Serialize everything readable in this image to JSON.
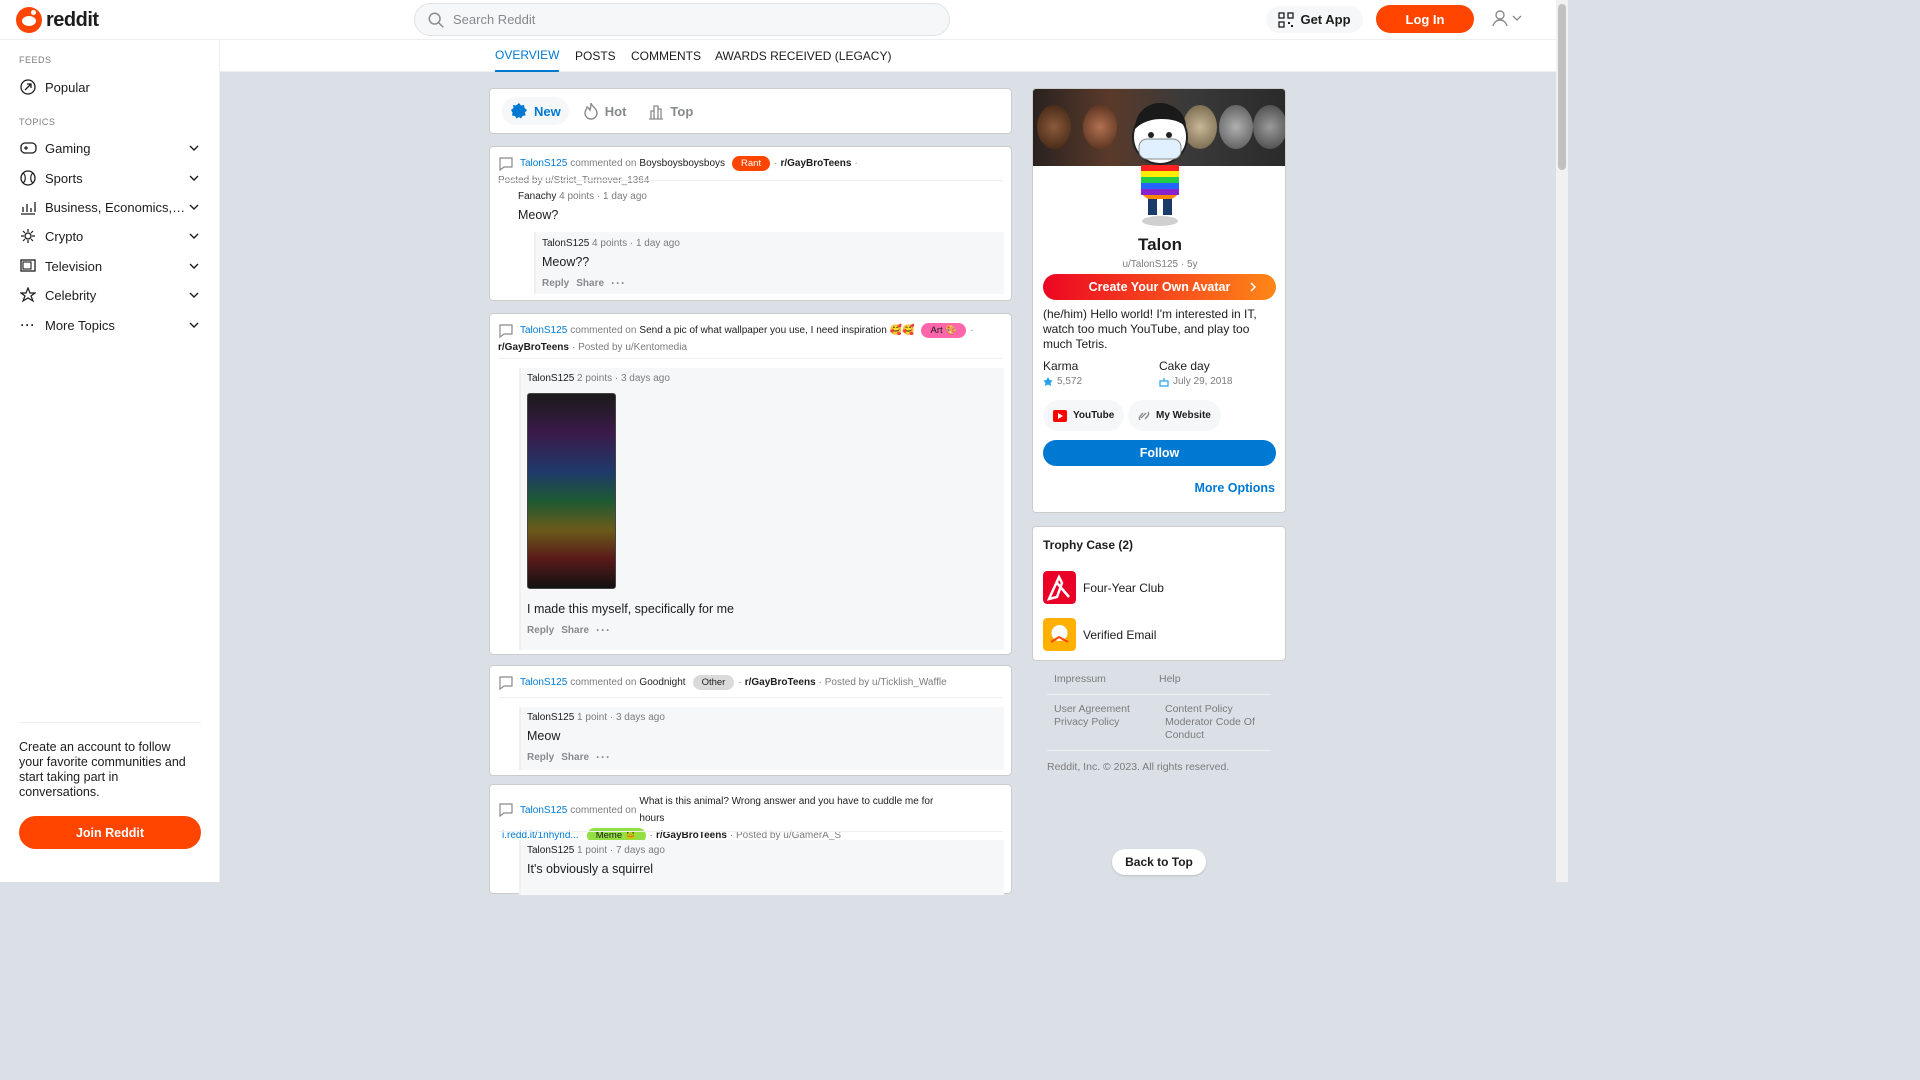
{
  "header": {
    "logo_text": "reddit",
    "search_placeholder": "Search Reddit",
    "get_app": "Get App",
    "login": "Log In"
  },
  "sidebar": {
    "feeds_label": "FEEDS",
    "popular": "Popular",
    "topics_label": "TOPICS",
    "topics": [
      "Gaming",
      "Sports",
      "Business, Economics, and Finance",
      "Crypto",
      "Television",
      "Celebrity",
      "More Topics"
    ],
    "cta": "Create an account to follow your favorite communities and start taking part in conversations.",
    "join": "Join Reddit"
  },
  "tabs": [
    "OVERVIEW",
    "POSTS",
    "COMMENTS",
    "AWARDS RECEIVED (LEGACY)"
  ],
  "sort": {
    "new": "New",
    "hot": "Hot",
    "top": "Top"
  },
  "actions": {
    "reply": "Reply",
    "share": "Share"
  },
  "cards": [
    {
      "user": "TalonS125",
      "verb": "commented on",
      "post_title": "Boysboysboysboys",
      "flair": "Rant",
      "community": "r/GayBroTeens",
      "posted_by": "Posted by u/Strict_Turnover_1364",
      "parent": {
        "author": "Fanachy",
        "meta": "4 points · 1 day ago",
        "body": "Meow?"
      },
      "reply": {
        "author": "TalonS125",
        "meta": "4 points · 1 day ago",
        "body": "Meow??"
      }
    },
    {
      "user": "TalonS125",
      "verb": "commented on",
      "post_title": "Send a pic of what wallpaper you use, I need inspiration 🥰🥰",
      "flair": "Art 🎨",
      "community": "r/GayBroTeens",
      "posted_by": "Posted by u/Kentomedia",
      "reply": {
        "author": "TalonS125",
        "meta": "2 points · 3 days ago",
        "body": "I made this myself, specifically for me"
      }
    },
    {
      "user": "TalonS125",
      "verb": "commented on",
      "post_title": "Goodnight",
      "flair": "Other",
      "community": "r/GayBroTeens",
      "posted_by": "Posted by u/Ticklish_Waffle",
      "reply": {
        "author": "TalonS125",
        "meta": "1 point · 3 days ago",
        "body": "Meow"
      }
    },
    {
      "user": "TalonS125",
      "verb": "commented on",
      "post_title": "What is this animal? Wrong answer and you have to cuddle me for hours",
      "link": "i.redd.it/1nhynd...",
      "flair": "Meme 🐸",
      "community": "r/GayBroTeens",
      "posted_by": "Posted by u/GamerA_S",
      "reply": {
        "author": "TalonS125",
        "meta": "1 point · 7 days ago",
        "body": "It's obviously a squirrel"
      }
    }
  ],
  "profile": {
    "name": "Talon",
    "handle": "u/TalonS125 · 5y",
    "create_avatar": "Create Your Own Avatar",
    "bio": "(he/him) Hello world! I'm interested in IT, watch too much YouTube, and play too much Tetris.",
    "karma_label": "Karma",
    "karma_value": "5,572",
    "cake_label": "Cake day",
    "cake_value": "July 29, 2018",
    "link1": "YouTube",
    "link2": "My Website",
    "follow": "Follow",
    "more_options": "More Options"
  },
  "trophies": {
    "title": "Trophy Case (2)",
    "items": [
      "Four-Year Club",
      "Verified Email"
    ]
  },
  "footer": {
    "impressum": "Impressum",
    "help": "Help",
    "user_agreement": "User Agreement",
    "privacy_policy": "Privacy Policy",
    "content_policy": "Content Policy",
    "moderator_code": "Moderator Code Of Conduct",
    "copyright": "Reddit, Inc. © 2023. All rights reserved."
  },
  "back_to_top": "Back to Top",
  "colors": {
    "accent": "#ff4500",
    "link": "#0079d3",
    "rant_flair": "#ff4500",
    "art_flair": "#ff66ac",
    "other_flair": "#dadada",
    "meme_flair": "#94e044"
  }
}
